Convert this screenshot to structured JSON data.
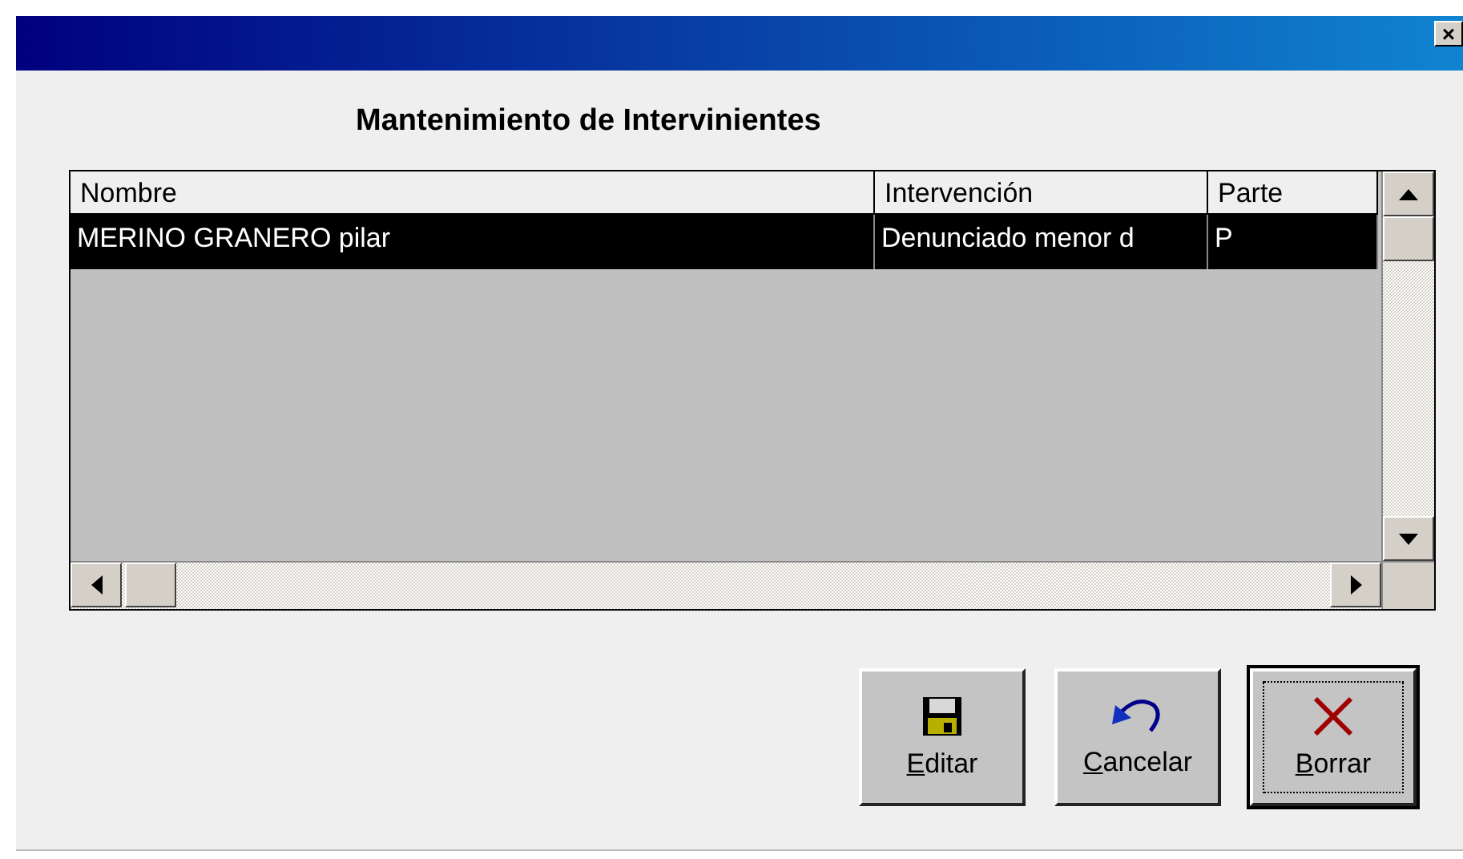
{
  "window": {
    "close": "×"
  },
  "title": "Mantenimiento de Intervinientes",
  "table": {
    "columns": [
      "Nombre",
      "Intervención",
      "Parte"
    ],
    "rows": [
      {
        "cells": [
          "MERINO GRANERO pilar",
          "Denunciado menor d",
          "P"
        ],
        "selected": true
      }
    ]
  },
  "buttons": [
    {
      "label": "Editar",
      "kind": "save",
      "focused": false
    },
    {
      "label": "Cancelar",
      "kind": "undo",
      "focused": false
    },
    {
      "label": "Borrar",
      "kind": "delete",
      "focused": true
    }
  ]
}
